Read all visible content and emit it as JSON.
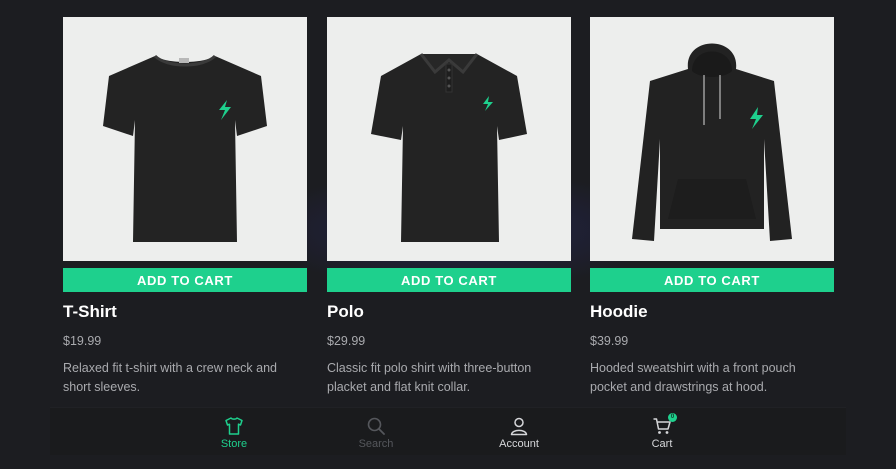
{
  "products": [
    {
      "name": "T-Shirt",
      "price": "$19.99",
      "description": "Relaxed fit t-shirt with a crew neck and short sleeves.",
      "button_label": "ADD TO CART",
      "image_icon": "tshirt-image"
    },
    {
      "name": "Polo",
      "price": "$29.99",
      "description": "Classic fit polo shirt with three-button placket and flat knit collar.",
      "button_label": "ADD TO CART",
      "image_icon": "polo-image"
    },
    {
      "name": "Hoodie",
      "price": "$39.99",
      "description": "Hooded sweatshirt with a front pouch pocket and drawstrings at hood.",
      "button_label": "ADD TO CART",
      "image_icon": "hoodie-image"
    }
  ],
  "bottom_nav": {
    "items": [
      {
        "label": "Store",
        "icon": "shirt-icon",
        "active": true,
        "color": "#1ed08d"
      },
      {
        "label": "Search",
        "icon": "search-icon",
        "active": false,
        "color": "#55575c"
      },
      {
        "label": "Account",
        "icon": "user-icon",
        "active": false,
        "color": "#d6d7da"
      },
      {
        "label": "Cart",
        "icon": "cart-icon",
        "active": false,
        "color": "#d6d7da",
        "badge": "0"
      }
    ]
  },
  "colors": {
    "accent": "#1ed08d",
    "background": "#1c1d21",
    "product_bg": "#edeeed",
    "muted_text": "#a9aaae"
  }
}
